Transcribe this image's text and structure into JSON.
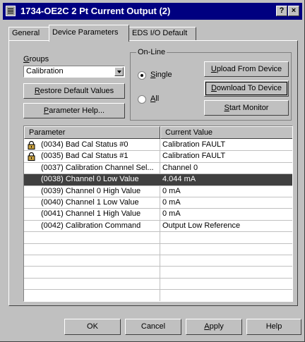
{
  "window": {
    "title": "1734-OE2C 2 Pt Current Output (2)",
    "help_glyph": "?",
    "close_glyph": "×"
  },
  "tabs": [
    {
      "label": "General"
    },
    {
      "label": "Device Parameters"
    },
    {
      "label": "EDS I/O Default"
    }
  ],
  "groups": {
    "label_first": "G",
    "label_rest": "roups",
    "selected": "Calibration"
  },
  "buttons": {
    "restore_first": "R",
    "restore_rest": "estore Default Values",
    "param_help_first": "P",
    "param_help_rest": "arameter Help...",
    "upload_first": "U",
    "upload_rest": "pload From Device",
    "download_first": "D",
    "download_rest": "ownload To Device",
    "monitor_pre": "",
    "monitor_first": "S",
    "monitor_rest": "tart Monitor"
  },
  "online": {
    "caption": "On-Line",
    "single_first": "S",
    "single_rest": "ingle",
    "all_first": "A",
    "all_rest": "ll",
    "selected": "Single"
  },
  "table": {
    "columns": [
      "Parameter",
      "Current Value"
    ],
    "rows": [
      {
        "parameter": "(0034) Bad Cal Status #0",
        "value": "Calibration FAULT",
        "icon": "lock-icon"
      },
      {
        "parameter": "(0035) Bad Cal Status #1",
        "value": "Calibration FAULT",
        "icon": "lock-icon"
      },
      {
        "parameter": "(0037) Calibration Channel Sel...",
        "value": "Channel 0",
        "icon": ""
      },
      {
        "parameter": "(0038) Channel 0 Low Value",
        "value": "4.044 mA",
        "icon": "",
        "selected": true
      },
      {
        "parameter": "(0039) Channel 0 High Value",
        "value": "0 mA",
        "icon": ""
      },
      {
        "parameter": "(0040) Channel 1 Low Value",
        "value": "0 mA",
        "icon": ""
      },
      {
        "parameter": "(0041) Channel 1 High Value",
        "value": "0 mA",
        "icon": ""
      },
      {
        "parameter": "(0042) Calibration Command",
        "value": "Output Low Reference",
        "icon": ""
      }
    ]
  },
  "footer": {
    "ok": "OK",
    "cancel": "Cancel",
    "apply_first": "A",
    "apply_rest": "pply",
    "help": "Help"
  }
}
